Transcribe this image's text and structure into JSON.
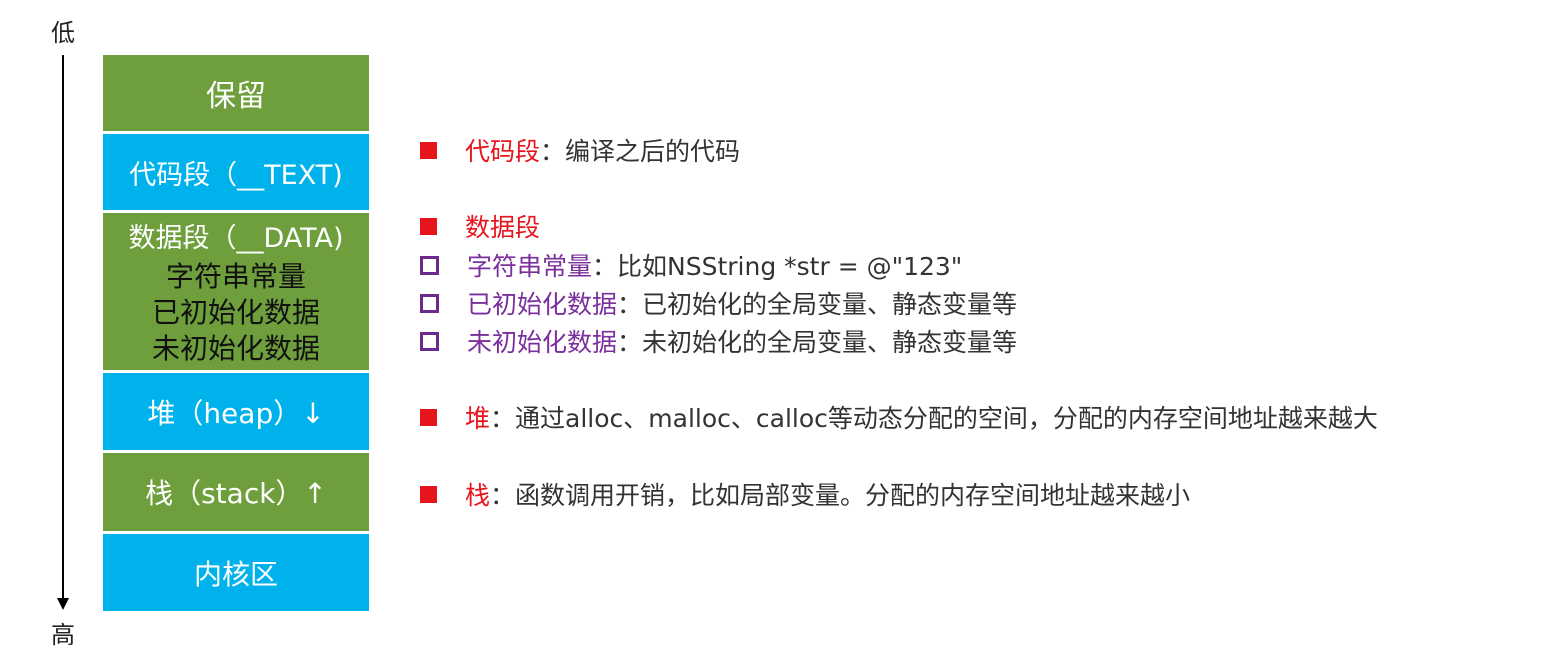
{
  "axis": {
    "low_label": "低",
    "high_label": "高"
  },
  "segments": [
    {
      "lines": [
        "保留"
      ],
      "color": "green"
    },
    {
      "lines": [
        "代码段（__TEXT)"
      ],
      "color": "blue"
    },
    {
      "lines": [
        "数据段（__DATA)",
        "字符串常量",
        "已初始化数据",
        "未初始化数据"
      ],
      "color": "green"
    },
    {
      "lines": [
        "堆（heap）↓"
      ],
      "color": "blue"
    },
    {
      "lines": [
        "栈（stack）↑"
      ],
      "color": "green"
    },
    {
      "lines": [
        "内核区"
      ],
      "color": "blue"
    }
  ],
  "descriptions": [
    {
      "bullet": "filled",
      "term": "代码段",
      "text": "：编译之后的代码"
    },
    {
      "bullet": "filled",
      "term": "数据段",
      "text": ""
    },
    {
      "bullet": "hollow",
      "term": "字符串常量",
      "text": "：比如NSString *str = @\"123\""
    },
    {
      "bullet": "hollow",
      "term": "已初始化数据",
      "text": "：已初始化的全局变量、静态变量等"
    },
    {
      "bullet": "hollow",
      "term": "未初始化数据",
      "text": "：未初始化的全局变量、静态变量等"
    },
    {
      "bullet": "filled",
      "term": "堆",
      "text": "：通过alloc、malloc、calloc等动态分配的空间，分配的内存空间地址越来越大"
    },
    {
      "bullet": "filled",
      "term": "栈",
      "text": "：函数调用开销，比如局部变量。分配的内存空间地址越来越小"
    }
  ],
  "colors": {
    "green": "#6e9f3c",
    "blue": "#00b2ec",
    "bullet_red": "#e8141c",
    "bullet_purple": "#6d2a8e"
  }
}
